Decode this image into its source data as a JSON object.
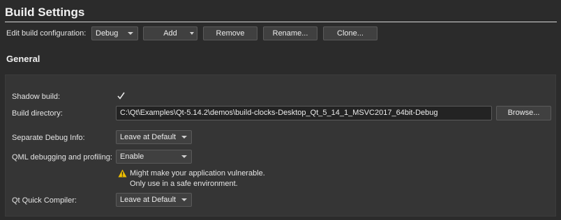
{
  "header": {
    "title": "Build Settings"
  },
  "config_bar": {
    "label": "Edit build configuration:",
    "config_value": "Debug",
    "add_label": "Add",
    "remove_label": "Remove",
    "rename_label": "Rename...",
    "clone_label": "Clone..."
  },
  "general": {
    "title": "General",
    "shadow_build_label": "Shadow build:",
    "shadow_build_checked": true,
    "build_dir_label": "Build directory:",
    "build_dir_value": "C:\\Qt\\Examples\\Qt-5.14.2\\demos\\build-clocks-Desktop_Qt_5_14_1_MSVC2017_64bit-Debug",
    "browse_label": "Browse...",
    "debug_info_label": "Separate Debug Info:",
    "debug_info_value": "Leave at Default",
    "qml_debug_label": "QML debugging and profiling:",
    "qml_debug_value": "Enable",
    "warning_line1": "Might make your application vulnerable.",
    "warning_line2": "Only use in a safe environment.",
    "quick_compiler_label": "Qt Quick Compiler:",
    "quick_compiler_value": "Leave at Default"
  },
  "colors": {
    "warning_icon": "#f0c000",
    "background": "#2b2b2b",
    "panel": "#353535"
  },
  "icons": {
    "check": "checkmark-icon",
    "warning": "warning-icon",
    "dropdown": "chevron-down-icon"
  }
}
